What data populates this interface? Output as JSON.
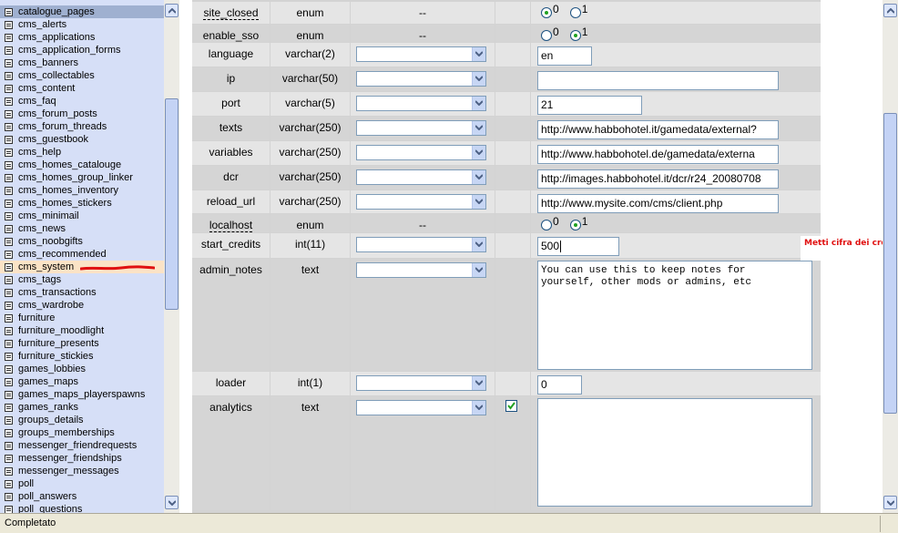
{
  "sidebar": {
    "tables": [
      "catalogue_pages",
      "cms_alerts",
      "cms_applications",
      "cms_application_forms",
      "cms_banners",
      "cms_collectables",
      "cms_content",
      "cms_faq",
      "cms_forum_posts",
      "cms_forum_threads",
      "cms_guestbook",
      "cms_help",
      "cms_homes_catalouge",
      "cms_homes_group_linker",
      "cms_homes_inventory",
      "cms_homes_stickers",
      "cms_minimail",
      "cms_news",
      "cms_noobgifts",
      "cms_recommended",
      "cms_system",
      "cms_tags",
      "cms_transactions",
      "cms_wardrobe",
      "furniture",
      "furniture_moodlight",
      "furniture_presents",
      "furniture_stickies",
      "games_lobbies",
      "games_maps",
      "games_maps_playerspawns",
      "games_ranks",
      "groups_details",
      "groups_memberships",
      "messenger_friendrequests",
      "messenger_friendships",
      "messenger_messages",
      "poll",
      "poll_answers",
      "poll_questions"
    ],
    "selected_index": 0,
    "highlighted_index": 20
  },
  "fields": [
    {
      "name": "site_closed",
      "type": "enum",
      "function": "--",
      "kind": "radio",
      "options": [
        "0",
        "1"
      ],
      "selected": "0",
      "underline": true
    },
    {
      "name": "enable_sso",
      "type": "enum",
      "function": "--",
      "kind": "radio",
      "options": [
        "0",
        "1"
      ],
      "selected": "1"
    },
    {
      "name": "language",
      "type": "varchar(2)",
      "kind": "input",
      "value": "en"
    },
    {
      "name": "ip",
      "type": "varchar(50)",
      "kind": "input",
      "value": ""
    },
    {
      "name": "port",
      "type": "varchar(5)",
      "kind": "input",
      "value": "21"
    },
    {
      "name": "texts",
      "type": "varchar(250)",
      "kind": "input",
      "value": "http://www.habbohotel.it/gamedata/external?"
    },
    {
      "name": "variables",
      "type": "varchar(250)",
      "kind": "input",
      "value": "http://www.habbohotel.de/gamedata/externa"
    },
    {
      "name": "dcr",
      "type": "varchar(250)",
      "kind": "input",
      "value": "http://images.habbohotel.it/dcr/r24_20080708"
    },
    {
      "name": "reload_url",
      "type": "varchar(250)",
      "kind": "input",
      "value": "http://www.mysite.com/cms/client.php"
    },
    {
      "name": "localhost",
      "type": "enum",
      "function": "--",
      "kind": "radio",
      "options": [
        "0",
        "1"
      ],
      "selected": "1",
      "underline": true
    },
    {
      "name": "start_credits",
      "type": "int(11)",
      "kind": "input",
      "value": "500"
    },
    {
      "name": "admin_notes",
      "type": "text",
      "kind": "textarea",
      "value": "You can use this to keep notes for\nyourself, other mods or admins, etc"
    },
    {
      "name": "loader",
      "type": "int(1)",
      "kind": "input",
      "value": "0"
    },
    {
      "name": "analytics",
      "type": "text",
      "kind": "textarea",
      "value": "",
      "null_checked": true
    }
  ],
  "annotation": "Metti cifra dei crediti che vuoi dare",
  "status": {
    "text": "Completato"
  },
  "colors": {
    "sidebar_bg": "#d6dff7",
    "row_light": "#e5e5e5",
    "row_dark": "#d5d5d5",
    "annotation_red": "#e01010",
    "highlight": "#fbe3c6"
  }
}
